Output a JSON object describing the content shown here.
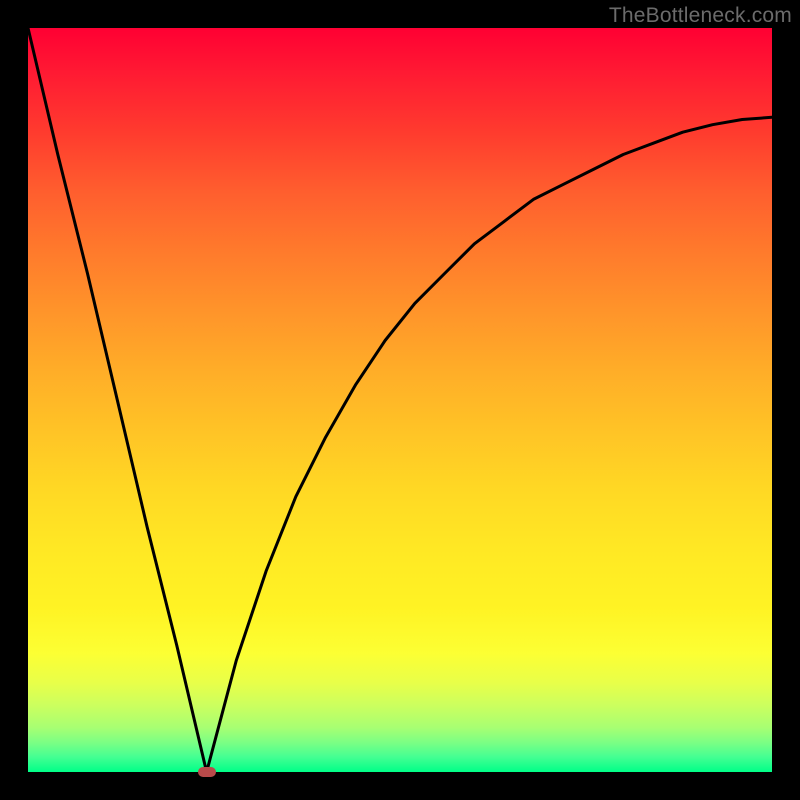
{
  "watermark": "TheBottleneck.com",
  "colors": {
    "frame": "#000000",
    "curve": "#000000",
    "marker": "#b84a4a",
    "gradient_top": "#ff0033",
    "gradient_bottom": "#00ff88"
  },
  "chart_data": {
    "type": "line",
    "title": "",
    "xlabel": "",
    "ylabel": "",
    "xlim": [
      0,
      100
    ],
    "ylim": [
      0,
      100
    ],
    "grid": false,
    "legend": false,
    "notes": "V-shaped bottleneck curve: y ≈ 100 at x≈0, descends linearly to 0 at the optimal point x≈24, then rises along a saturating curve toward ≈88 at x=100. Background is a vertical red→green gradient. A small rounded marker sits at the minimum.",
    "optimal_x": 24,
    "marker": {
      "x": 24,
      "y": 0
    },
    "series": [
      {
        "name": "bottleneck-curve",
        "x": [
          0,
          4,
          8,
          12,
          16,
          20,
          24,
          28,
          32,
          36,
          40,
          44,
          48,
          52,
          56,
          60,
          64,
          68,
          72,
          76,
          80,
          84,
          88,
          92,
          96,
          100
        ],
        "y": [
          100,
          83,
          67,
          50,
          33,
          17,
          0,
          15,
          27,
          37,
          45,
          52,
          58,
          63,
          67,
          71,
          74,
          77,
          79,
          81,
          83,
          84.5,
          86,
          87,
          87.7,
          88
        ]
      }
    ]
  }
}
